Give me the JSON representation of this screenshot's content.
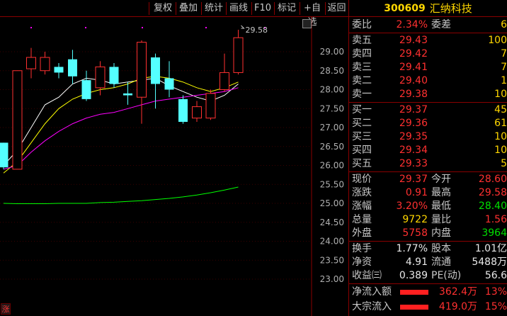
{
  "toolbar": {
    "buttons": [
      "复权",
      "叠加",
      "统计",
      "画线",
      "F10",
      "标记",
      "+自选",
      "返回"
    ]
  },
  "chart": {
    "y_ticks": [
      "29.00",
      "28.50",
      "28.00",
      "27.50",
      "27.00",
      "26.50",
      "26.00",
      "25.50",
      "25.00",
      "24.50",
      "24.00",
      "23.50",
      "23.00"
    ],
    "high_label": "29.58",
    "bottom_tag": "涨",
    "colors": {
      "up": "#ff3030",
      "down": "#54ffff",
      "ma5": "#ffffff",
      "ma10": "#ffff00",
      "ma20": "#ff00ff",
      "ma60": "#00ff00"
    }
  },
  "chart_data": {
    "type": "candlestick",
    "ylim": [
      22.8,
      29.9
    ],
    "y_ticks": [
      29.0,
      28.5,
      28.0,
      27.5,
      27.0,
      26.5,
      26.0,
      25.5,
      25.0,
      24.5,
      24.0,
      23.5,
      23.0
    ],
    "candles": [
      {
        "o": 26.6,
        "c": 25.95,
        "h": 26.6,
        "l": 25.9
      },
      {
        "o": 25.9,
        "c": 28.5,
        "h": 28.5,
        "l": 25.9
      },
      {
        "o": 28.55,
        "c": 28.85,
        "h": 29.1,
        "l": 28.3
      },
      {
        "o": 28.5,
        "c": 28.85,
        "h": 29.0,
        "l": 28.4
      },
      {
        "o": 28.6,
        "c": 28.45,
        "h": 28.7,
        "l": 28.3
      },
      {
        "o": 28.8,
        "c": 28.35,
        "h": 29.05,
        "l": 28.15
      },
      {
        "o": 28.25,
        "c": 27.75,
        "h": 28.5,
        "l": 27.7
      },
      {
        "o": 28.05,
        "c": 28.6,
        "h": 28.75,
        "l": 27.85
      },
      {
        "o": 28.6,
        "c": 28.15,
        "h": 28.7,
        "l": 28.05
      },
      {
        "o": 27.9,
        "c": 27.85,
        "h": 28.2,
        "l": 27.6
      },
      {
        "o": 27.8,
        "c": 29.25,
        "h": 29.3,
        "l": 27.1
      },
      {
        "o": 28.85,
        "c": 28.15,
        "h": 28.95,
        "l": 27.5
      },
      {
        "o": 28.3,
        "c": 28.0,
        "h": 28.75,
        "l": 27.8
      },
      {
        "o": 27.75,
        "c": 27.15,
        "h": 27.85,
        "l": 27.1
      },
      {
        "o": 27.25,
        "c": 27.55,
        "h": 27.7,
        "l": 27.15
      },
      {
        "o": 27.25,
        "c": 27.9,
        "h": 28.0,
        "l": 27.2
      },
      {
        "o": 28.0,
        "c": 28.45,
        "h": 28.95,
        "l": 27.95
      },
      {
        "o": 28.45,
        "c": 29.37,
        "h": 29.58,
        "l": 28.4
      }
    ],
    "ma_lines": [
      {
        "name": "MA5",
        "values": [
          26.0,
          26.4,
          27.0,
          27.6,
          27.8,
          28.15,
          28.3,
          28.25,
          28.15,
          28.2,
          28.25,
          28.3,
          28.1,
          27.95,
          27.8,
          27.7,
          27.85,
          28.15
        ]
      },
      {
        "name": "MA10",
        "values": [
          25.8,
          26.1,
          26.6,
          27.1,
          27.5,
          27.75,
          27.9,
          28.0,
          28.05,
          28.15,
          28.3,
          28.35,
          28.3,
          28.2,
          28.05,
          27.95,
          28.05,
          28.2
        ]
      },
      {
        "name": "MA20",
        "values": [
          25.9,
          26.0,
          26.35,
          26.65,
          26.9,
          27.1,
          27.25,
          27.35,
          27.4,
          27.5,
          27.6,
          27.7,
          27.75,
          27.8,
          27.85,
          27.9,
          27.95,
          28.05
        ]
      },
      {
        "name": "MA60",
        "values": [
          25.0,
          24.99,
          24.99,
          24.99,
          25.0,
          25.0,
          25.0,
          25.02,
          25.03,
          25.05,
          25.07,
          25.1,
          25.13,
          25.17,
          25.22,
          25.28,
          25.35,
          25.43
        ]
      }
    ]
  },
  "stock": {
    "code": "300609",
    "name": "汇纳科技"
  },
  "weibi": {
    "label1": "委比",
    "value1": "2.34%",
    "label2": "委差",
    "value2": "6"
  },
  "asks": [
    {
      "label": "卖五",
      "price": "29.43",
      "vol": "100"
    },
    {
      "label": "卖四",
      "price": "29.42",
      "vol": "7"
    },
    {
      "label": "卖三",
      "price": "29.41",
      "vol": "7"
    },
    {
      "label": "卖二",
      "price": "29.40",
      "vol": "1"
    },
    {
      "label": "卖一",
      "price": "29.38",
      "vol": "10"
    }
  ],
  "bids": [
    {
      "label": "买一",
      "price": "29.37",
      "vol": "45"
    },
    {
      "label": "买二",
      "price": "29.36",
      "vol": "61"
    },
    {
      "label": "买三",
      "price": "29.35",
      "vol": "10"
    },
    {
      "label": "买四",
      "price": "29.34",
      "vol": "10"
    },
    {
      "label": "买五",
      "price": "29.33",
      "vol": "5"
    }
  ],
  "quote": [
    {
      "l1": "现价",
      "v1": "29.37",
      "l2": "今开",
      "v2": "28.60"
    },
    {
      "l1": "涨跌",
      "v1": "0.91",
      "l2": "最高",
      "v2": "29.58"
    },
    {
      "l1": "涨幅",
      "v1": "3.20%",
      "l2": "最低",
      "v2": "28.40"
    },
    {
      "l1": "总量",
      "v1": "9722",
      "l2": "量比",
      "v2": "1.56"
    },
    {
      "l1": "外盘",
      "v1": "5758",
      "l2": "内盘",
      "v2": "3964"
    }
  ],
  "fundamentals": [
    {
      "l1": "换手",
      "v1": "1.77%",
      "l2": "股本",
      "v2": "1.01亿"
    },
    {
      "l1": "净资",
      "v1": "4.91",
      "l2": "流通",
      "v2": "5488万"
    },
    {
      "l1": "收益㈢",
      "v1": "0.389",
      "l2": "PE(动)",
      "v2": "56.6"
    }
  ],
  "flows": [
    {
      "label": "净流入额",
      "value": "362.4万",
      "pct": "13%"
    },
    {
      "label": "大宗流入",
      "value": "419.0万",
      "pct": "15%"
    }
  ]
}
